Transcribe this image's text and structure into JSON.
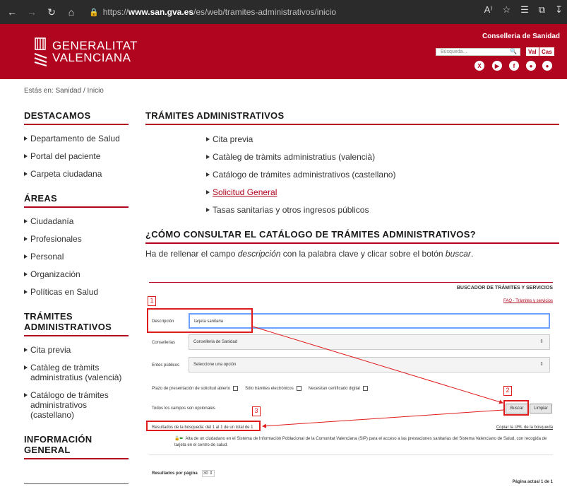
{
  "browser": {
    "url_prefix": "https://",
    "url_domain": "www.san.gva.es",
    "url_path": "/es/web/tramites-administrativos/inicio",
    "read_aloud": "A⁾"
  },
  "header": {
    "brand_line1": "GENERALITAT",
    "brand_line2": "VALENCIANA",
    "conselleria": "Conselleria de Sanidad",
    "search_placeholder": "Búsqueda...",
    "lang_val": "Val",
    "lang_cas": "Cas",
    "social": [
      "X",
      "▶",
      "f",
      "●",
      "●"
    ]
  },
  "breadcrumb": "Estás en: Sanidad  /  Inicio",
  "sidebar": {
    "destacamos": "DESTACAMOS",
    "destacamos_items": [
      "Departamento de Salud",
      "Portal del paciente",
      "Carpeta ciudadana"
    ],
    "areas": "ÁREAS",
    "areas_items": [
      "Ciudadanía",
      "Profesionales",
      "Personal",
      "Organización",
      "Políticas en Salud"
    ],
    "tramites": "TRÁMITES ADMINISTRATIVOS",
    "tramites_items": [
      "Cita previa",
      "Catàleg de tràmits administratius (valencià)",
      "Catálogo de trámites administrativos (castellano)"
    ],
    "informacion": "INFORMACIÓN GENERAL"
  },
  "main": {
    "title": "TRÁMITES ADMINISTRATIVOS",
    "items": [
      "Cita previa",
      "Catàleg de tràmits administratius (valencià)",
      "Catálogo de trámites administrativos (castellano)",
      "Solicitud General",
      "Tasas sanitarias y otros ingresos públicos"
    ],
    "how_title": "¿CÓMO CONSULTAR EL CATÁLOGO DE TRÁMITES ADMINISTRATIVOS?",
    "how_text_1": "Ha de rellenar el campo ",
    "how_text_em1": "descripción",
    "how_text_2": " con la palabra clave y clicar sobre el botón ",
    "how_text_em2": "buscar",
    "how_text_3": "."
  },
  "buscador": {
    "title": "BUSCADOR DE TRÁMITES Y SERVICIOS",
    "faq": "FAQ - Trámites y servicios",
    "descripcion_label": "Descripción",
    "descripcion_value": "tarjeta sanitaria",
    "consellerias_label": "Consellerias",
    "consellerias_value": "Conselleria de Sanidad",
    "entes_label": "Entes públicos",
    "entes_value": "Seleccione una opción",
    "chk1": "Plazo de presentación de solicitud abierto",
    "chk2": "Sólo trámites electrónicos",
    "chk3": "Necesitan certificado digital",
    "optional": "Todos los campos son opcionales",
    "buscar": "Buscar",
    "limpiar": "Limpiar",
    "results": "Resultados de la búsqueda: del 1 al 1 de un total de 1",
    "copy_url": "Copiar la URL de la búsqueda",
    "alta": "Alta de un ciudadano en el Sistema de Información Poblacional de la Comunitat Valenciana (SIP) para el acceso a las prestaciones sanitarias del Sistema Valenciano de Salud, con recogida de tarjeta en el centro de salud.",
    "per_page_label": "Resultados por página",
    "per_page_value": "30 ⇕",
    "page": "Página actual 1 de 1"
  },
  "annotations": {
    "n1": "1",
    "n2": "2",
    "n3": "3",
    "color": "#e01b1b"
  },
  "colors": {
    "brand": "#b1041f",
    "browser_bar": "#2b2b2b"
  }
}
